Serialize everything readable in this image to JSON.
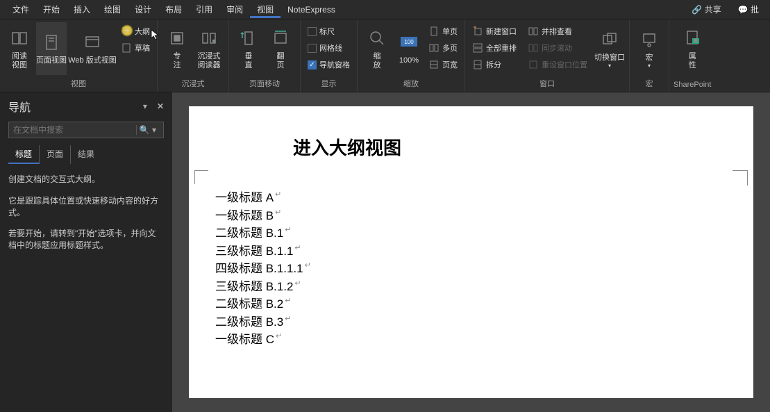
{
  "menus": [
    "文件",
    "开始",
    "插入",
    "绘图",
    "设计",
    "布局",
    "引用",
    "审阅",
    "视图",
    "NoteExpress"
  ],
  "active_menu": "视图",
  "top_right": {
    "share": "共享",
    "comments": "批"
  },
  "ribbon": {
    "views_group": {
      "label": "视图",
      "buttons": {
        "read": "阅读\n视图",
        "print": "页面视图",
        "web": "Web 版式视图",
        "outline": "大纲",
        "draft": "草稿"
      }
    },
    "immersive_group": {
      "label": "沉浸式",
      "focus": "专\n注",
      "reader": "沉浸式\n阅读器"
    },
    "page_move_group": {
      "label": "页面移动",
      "vertical": "垂\n直",
      "flip": "翻\n页"
    },
    "show_group": {
      "label": "显示",
      "ruler": "标尺",
      "gridlines": "网格线",
      "nav_pane": "导航窗格",
      "ruler_checked": false,
      "gridlines_checked": false,
      "nav_pane_checked": true
    },
    "zoom_group": {
      "label": "缩放",
      "zoom": "缩\n放",
      "hundred": "100%",
      "one_page": "单页",
      "multi_page": "多页",
      "page_width": "页宽"
    },
    "window_group": {
      "label": "窗口",
      "new_window": "新建窗口",
      "arrange_all": "全部重排",
      "split": "拆分",
      "side_by_side": "并排查看",
      "sync_scroll": "同步滚动",
      "reset_pos": "重设窗口位置",
      "switch": "切换窗口"
    },
    "macros_group": {
      "label": "宏",
      "macros": "宏"
    },
    "sharepoint_group": {
      "label": "SharePoint",
      "props": "属\n性"
    }
  },
  "nav": {
    "title": "导航",
    "search_placeholder": "在文档中搜索",
    "tabs": [
      "标题",
      "页面",
      "结果"
    ],
    "active_tab": "标题",
    "body_lines": [
      "创建文档的交互式大纲。",
      "它是跟踪具体位置或快速移动内容的好方式。",
      "若要开始，请转到\"开始\"选项卡，并向文档中的标题应用标题样式。"
    ]
  },
  "document": {
    "title": "进入大纲视图",
    "headings": [
      "一级标题 A",
      "一级标题 B",
      "二级标题 B.1",
      "三级标题 B.1.1",
      "四级标题 B.1.1.1",
      "三级标题 B.1.2",
      "二级标题 B.2",
      "二级标题 B.3",
      "一级标题 C"
    ]
  }
}
